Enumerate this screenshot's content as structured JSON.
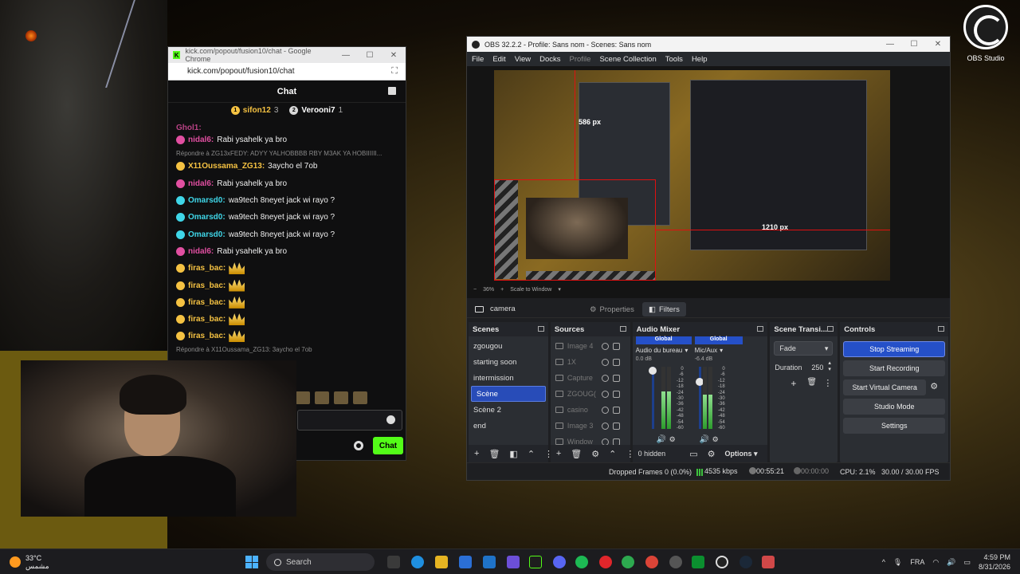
{
  "desktop": {
    "obs_icon_label": "OBS Studio"
  },
  "chrome": {
    "title": "kick.com/popout/fusion10/chat - Google Chrome",
    "url": "kick.com/popout/fusion10/chat",
    "chat_title": "Chat",
    "pinned": [
      {
        "name": "sifon12",
        "count": "3",
        "rank": "1",
        "color": "#f5c242"
      },
      {
        "name": "Veroonі7",
        "count": "1",
        "rank": "2",
        "color": "#d8d8d8"
      }
    ],
    "partial_top": "Ghol1:",
    "messages": [
      {
        "user": "nidal6:",
        "text": "Rabi ysahelk ya bro",
        "color": "#e14fa1"
      },
      {
        "reply": "Répondre à ZG13xFEDY: ADYY YALHOBBBB RBY M3AK YA HOBIIIIII..."
      },
      {
        "user": "X11Oussama_ZG13:",
        "text": "3aycho el 7ob",
        "color": "#f5c242"
      },
      {
        "user": "nidal6:",
        "text": "Rabi ysahelk ya bro",
        "color": "#e14fa1"
      },
      {
        "user": "Omarsd0:",
        "text": "wa9tech 8neyet jack wi rayo ?",
        "color": "#3fd6e8"
      },
      {
        "user": "Omarsd0:",
        "text": "wa9tech 8neyet jack wi rayo ?",
        "color": "#3fd6e8"
      },
      {
        "user": "Omarsd0:",
        "text": "wa9tech 8neyet jack wi rayo ?",
        "color": "#3fd6e8"
      },
      {
        "user": "nidal6:",
        "text": "Rabi ysahelk ya bro",
        "color": "#e14fa1"
      },
      {
        "user": "firas_bac:",
        "text": "",
        "color": "#f5c242",
        "emote": true
      },
      {
        "user": "firas_bac:",
        "text": "",
        "color": "#f5c242",
        "emote": true
      },
      {
        "user": "firas_bac:",
        "text": "",
        "color": "#f5c242",
        "emote": true
      },
      {
        "user": "firas_bac:",
        "text": "",
        "color": "#f5c242",
        "emote": true
      },
      {
        "user": "firas_bac:",
        "text": "",
        "color": "#f5c242",
        "emote": true
      },
      {
        "reply": "Répondre à X11Oussama_ZG13: 3aycho el 7ob"
      }
    ],
    "send_label": "Chat",
    "accent": "#53fc18"
  },
  "obs": {
    "title": "OBS 32.2.2 - Profile: Sans nom - Scenes: Sans nom",
    "menu": [
      "File",
      "Edit",
      "View",
      "Docks",
      "Profile",
      "Scene Collection",
      "Tools",
      "Help"
    ],
    "preview_labels": {
      "size1": "586 px",
      "size2": "1210 px"
    },
    "zoom": {
      "percent": "36%",
      "scale": "Scale to Window"
    },
    "source_name": "camera",
    "properties_label": "Properties",
    "filters_label": "Filters",
    "docks": {
      "scenes_title": "Scenes",
      "sources_title": "Sources",
      "mixer_title": "Audio Mixer",
      "transitions_title": "Scene Transi...",
      "controls_title": "Controls"
    },
    "scenes": [
      "zgougou",
      "starting soon",
      "intermission",
      "Scène",
      "Scène 2",
      "end"
    ],
    "selected_scene": 3,
    "sources": [
      "Image 4",
      "1X",
      "Capture",
      "ZGOUG(",
      "casino",
      "Image 3",
      "Window"
    ],
    "mixer": {
      "channels": [
        {
          "tag": "Global",
          "name": "Audio du bureau",
          "db": "0.0 dB",
          "level": 0.6
        },
        {
          "tag": "Global",
          "name": "Mic/Aux",
          "db": "-6.4 dB",
          "level": 0.55
        }
      ],
      "ticks": [
        "0",
        "-6",
        "-12",
        "-18",
        "-24",
        "-30",
        "-36",
        "-42",
        "-48",
        "-54",
        "-60"
      ],
      "hidden": "0 hidden",
      "options": "Options"
    },
    "transition": {
      "value": "Fade",
      "duration_label": "Duration",
      "duration": "250"
    },
    "controls": [
      "Stop Streaming",
      "Start Recording",
      "Start Virtual Camera",
      "Studio Mode",
      "Settings"
    ],
    "status": {
      "dropped": "Dropped Frames 0 (0.0%)",
      "bitrate": "4535 kbps",
      "live_time": "00:55:21",
      "rec_time": "00:00:00",
      "cpu": "CPU: 2.1%",
      "fps": "30.00 / 30.00 FPS"
    }
  },
  "taskbar": {
    "temp": "33°C",
    "weather": "مشمس",
    "search": "Search",
    "lang": "FRA",
    "time": "4:59 PM",
    "date": "8/31/2026"
  }
}
